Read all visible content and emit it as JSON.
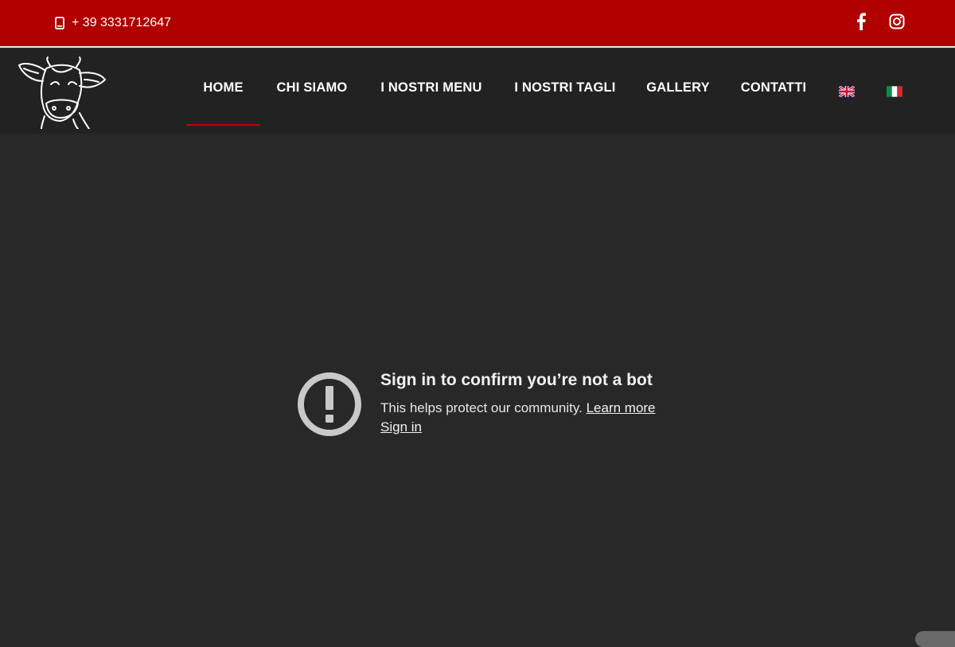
{
  "topbar": {
    "phone": "+ 39 3331712647",
    "social": [
      {
        "icon": "facebook-icon"
      },
      {
        "icon": "instagram-icon"
      }
    ],
    "bg_color": "#b00000"
  },
  "nav": {
    "items": [
      {
        "label": "HOME",
        "active": true
      },
      {
        "label": "CHI SIAMO"
      },
      {
        "label": "I NOSTRI MENU"
      },
      {
        "label": "I NOSTRI TAGLI"
      },
      {
        "label": "GALLERY"
      },
      {
        "label": "CONTATTI"
      }
    ],
    "languages": [
      {
        "icon": "uk-flag-icon"
      },
      {
        "icon": "italy-flag-icon"
      }
    ],
    "accent_color": "#c40000"
  },
  "embed": {
    "icon": "alert-icon",
    "title": "Sign in to confirm you’re not a bot",
    "body": "This helps protect our community.",
    "learn_more": "Learn more",
    "sign_in": "Sign in"
  }
}
